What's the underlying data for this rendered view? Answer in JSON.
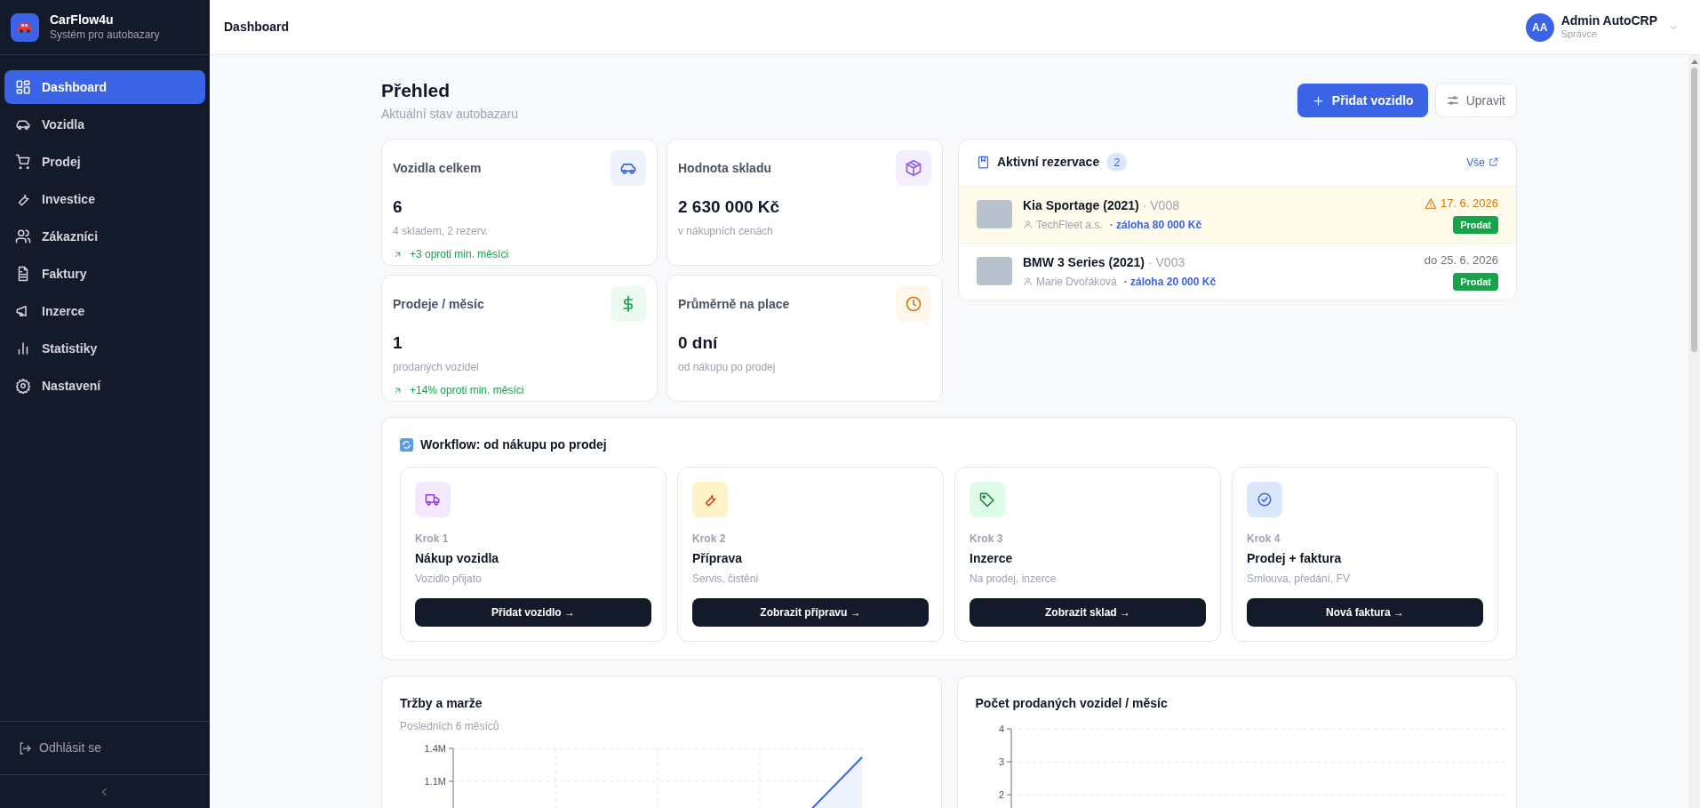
{
  "brand": {
    "name": "CarFlow4u",
    "tagline": "Systém pro autobazary"
  },
  "nav": [
    {
      "label": "Dashboard",
      "selected": true
    },
    {
      "label": "Vozidla",
      "selected": false
    },
    {
      "label": "Prodej",
      "selected": false
    },
    {
      "label": "Investice",
      "selected": false
    },
    {
      "label": "Zákazníci",
      "selected": false
    },
    {
      "label": "Faktury",
      "selected": false
    },
    {
      "label": "Inzerce",
      "selected": false
    },
    {
      "label": "Statistiky",
      "selected": false
    },
    {
      "label": "Nastavení",
      "selected": false
    }
  ],
  "logout": "Odhlásit se",
  "header": {
    "title": "Dashboard",
    "user": {
      "initials": "AA",
      "name": "Admin AutoCRP",
      "role": "Správce"
    }
  },
  "page": {
    "title": "Přehled",
    "subtitle": "Aktuální stav autobazaru",
    "actions": [
      {
        "label": "Přidat vozidlo",
        "kind": "primary"
      },
      {
        "label": "Upravit",
        "kind": "secondary"
      }
    ]
  },
  "stats": [
    {
      "label": "Vozidla celkem",
      "value": "6",
      "note": "4 skladem, 2 rezerv.",
      "trend": "+3 oproti min. měsíci"
    },
    {
      "label": "Hodnota skladu",
      "value": "2 630 000 Kč",
      "note": "v nákupních cenách"
    },
    {
      "label": "Prodeje / měsíc",
      "value": "1",
      "note": "prodaných vozidel",
      "trend": "+14% oproti min. měsíci"
    },
    {
      "label": "Průměrně na place",
      "value": "0 dní",
      "note": "od nákupu po prodej"
    }
  ],
  "reservations": {
    "title": "Aktivní rezervace",
    "count": "2",
    "link": "Vše",
    "items": [
      {
        "vehicle": "Kia Sportage (2021)",
        "code": "· V008",
        "customer": "TechFleet a.s.",
        "deposit": "· záloha 80 000 Kč",
        "date": "17. 6. 2026",
        "warning": true,
        "action": "Prodat"
      },
      {
        "vehicle": "BMW 3 Series (2021)",
        "code": "· V003",
        "customer": "Marie Dvořáková",
        "deposit": "· záloha 20 000 Kč",
        "date": "do 25. 6. 2026",
        "warning": false,
        "action": "Prodat"
      }
    ]
  },
  "workflow": {
    "title": "Workflow: od nákupu po prodej",
    "steps": [
      {
        "step": "Krok 1",
        "title": "Nákup vozidla",
        "note": "Vozidlo přijato",
        "button": "Přidat vozidlo →"
      },
      {
        "step": "Krok 2",
        "title": "Příprava",
        "note": "Servis, čistění",
        "button": "Zobrazit přípravu →"
      },
      {
        "step": "Krok 3",
        "title": "Inzerce",
        "note": "Na prodej, inzerce",
        "button": "Zobrazit sklad →"
      },
      {
        "step": "Krok 4",
        "title": "Prodej + faktura",
        "note": "Smlouva, předání, FV",
        "button": "Nová faktura →"
      }
    ]
  },
  "charts": [
    {
      "title": "Tržby a marže",
      "subtitle": "Posledních 6 měsíců",
      "kind": "line",
      "y_ticks": [
        "1.4M",
        "1.1M"
      ]
    },
    {
      "title": "Počet prodaných vozidel / měsíc",
      "kind": "bar",
      "y_ticks": [
        "4",
        "3",
        "2"
      ]
    }
  ]
}
